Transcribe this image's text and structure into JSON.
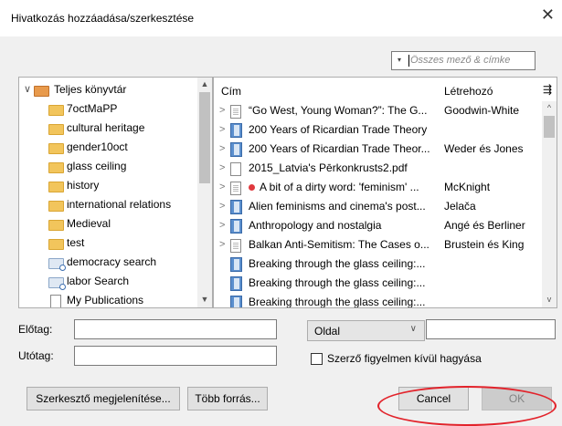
{
  "window": {
    "title": "Hivatkozás hozzáadása/szerkesztése",
    "close": "✕"
  },
  "search": {
    "placeholder": "Összes mező & címke",
    "dropdown_arrow": "▾"
  },
  "collections": {
    "root": {
      "label": "Teljes könyvtár",
      "expander": "∨"
    },
    "items": [
      {
        "label": "7octMaPP",
        "icon": "folder-icon"
      },
      {
        "label": "cultural heritage",
        "icon": "folder-icon"
      },
      {
        "label": "gender10oct",
        "icon": "folder-icon"
      },
      {
        "label": "glass ceiling",
        "icon": "folder-icon"
      },
      {
        "label": "history",
        "icon": "folder-icon"
      },
      {
        "label": "international relations",
        "icon": "folder-icon"
      },
      {
        "label": "Medieval",
        "icon": "folder-icon"
      },
      {
        "label": "test",
        "icon": "folder-icon"
      },
      {
        "label": "democracy search",
        "icon": "saved-search-icon"
      },
      {
        "label": "labor Search",
        "icon": "saved-search-icon"
      },
      {
        "label": "My Publications",
        "icon": "publications-icon"
      }
    ]
  },
  "items": {
    "columns": {
      "title": "Cím",
      "creator": "Létrehozó",
      "picker": "⇶"
    },
    "rows": [
      {
        "title": "“Go West, Young Woman?”: The G...",
        "creator": "Goodwin-White",
        "icon": "document-icon",
        "chevron": true,
        "dot": false
      },
      {
        "title": "200 Years of Ricardian Trade Theory",
        "creator": "",
        "icon": "book-icon",
        "chevron": true,
        "dot": false
      },
      {
        "title": "200 Years of Ricardian Trade Theor...",
        "creator": "Weder és Jones",
        "icon": "book-icon",
        "chevron": true,
        "dot": false
      },
      {
        "title": "2015_Latvia's Pērkonkrusts2.pdf",
        "creator": "",
        "icon": "pdf-icon",
        "chevron": true,
        "dot": false
      },
      {
        "title": "A bit of a dirty word: 'feminism' ...",
        "creator": "McKnight",
        "icon": "document-icon",
        "chevron": true,
        "dot": true
      },
      {
        "title": "Alien feminisms and cinema's post...",
        "creator": "Jelača",
        "icon": "book-icon",
        "chevron": true,
        "dot": false
      },
      {
        "title": "Anthropology and nostalgia",
        "creator": "Angé és Berliner",
        "icon": "book-icon",
        "chevron": true,
        "dot": false
      },
      {
        "title": "Balkan Anti-Semitism: The Cases o...",
        "creator": "Brustein és King",
        "icon": "document-icon",
        "chevron": true,
        "dot": false
      },
      {
        "title": "Breaking through the glass ceiling:...",
        "creator": "",
        "icon": "book-icon",
        "chevron": false,
        "dot": false
      },
      {
        "title": "Breaking through the glass ceiling:...",
        "creator": "",
        "icon": "book-icon",
        "chevron": false,
        "dot": false
      },
      {
        "title": "Breaking through the glass ceiling:...",
        "creator": "",
        "icon": "book-icon",
        "chevron": false,
        "dot": false
      }
    ]
  },
  "form": {
    "prefix_label": "Előtag:",
    "prefix_value": "",
    "suffix_label": "Utótag:",
    "suffix_value": "",
    "locator_select": "Oldal",
    "locator_value": "",
    "omit_author_label": "Szerző figyelmen kívül hagyása"
  },
  "buttons": {
    "show_editor": "Szerkesztő megjelenítése...",
    "multiple_sources": "Több forrás...",
    "cancel": "Cancel",
    "ok": "OK"
  },
  "annotation_color": "#e2232b"
}
